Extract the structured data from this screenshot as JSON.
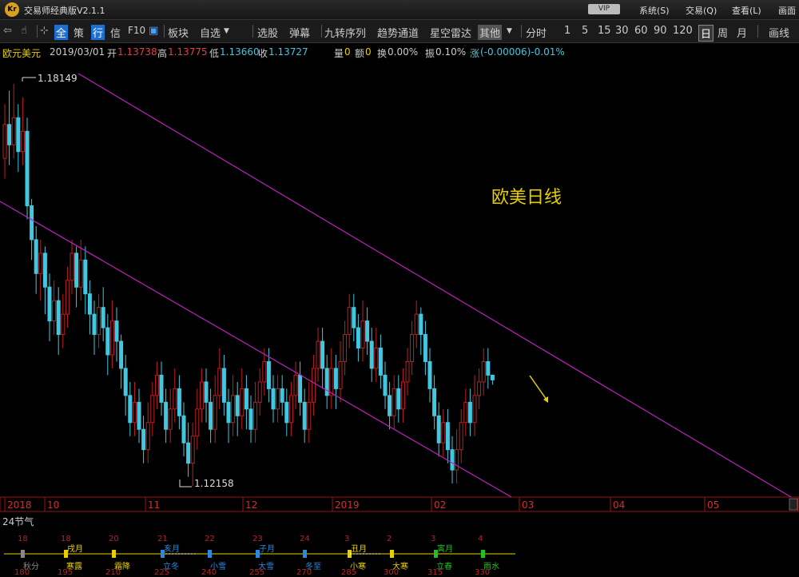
{
  "app": {
    "title": "交易师经典版V2.1.1",
    "logo": "Kr",
    "vip": "VIP",
    "menu": [
      "系统(S)",
      "交易(Q)",
      "查看(L)",
      "画面"
    ]
  },
  "toolbar": {
    "items": [
      "全",
      "策",
      "行",
      "信",
      "F10",
      "板块",
      "自选",
      "选股",
      "弹幕",
      "九转序列",
      "趋势通道",
      "星空雷达",
      "其他",
      "分时",
      "1",
      "5",
      "15",
      "30",
      "60",
      "90",
      "120",
      "日",
      "周",
      "月",
      "画线"
    ],
    "selected": [
      "全",
      "行",
      "日"
    ]
  },
  "quote": {
    "symbol": "欧元美元",
    "date": "2019/03/01",
    "open_label": "开",
    "open": "1.13738",
    "high_label": "高",
    "high": "1.13775",
    "low_label": "低",
    "low": "1.13660",
    "close_label": "收",
    "close": "1.13727",
    "vol_label": "量",
    "vol": "0",
    "amt_label": "额",
    "amt": "0",
    "turnover_label": "换",
    "turnover": "0.00%",
    "amp_label": "振",
    "amp": "0.10%",
    "chg_label": "涨",
    "chg": "(-0.00006)-0.01%"
  },
  "chart_data": {
    "type": "candlestick",
    "title": "欧美日线",
    "high_marker": "1.18149",
    "low_marker": "1.12158",
    "x_ticks": [
      "2018",
      "10",
      "11",
      "12",
      "2019",
      "02",
      "03",
      "04",
      "05"
    ],
    "candles": [
      {
        "o": 1.17,
        "c": 1.175,
        "h": 1.178,
        "l": 1.167
      },
      {
        "o": 1.175,
        "c": 1.172,
        "h": 1.18,
        "l": 1.169
      },
      {
        "o": 1.172,
        "c": 1.176,
        "h": 1.181,
        "l": 1.17
      },
      {
        "o": 1.176,
        "c": 1.171,
        "h": 1.178,
        "l": 1.168
      },
      {
        "o": 1.171,
        "c": 1.174,
        "h": 1.179,
        "l": 1.169
      },
      {
        "o": 1.174,
        "c": 1.163,
        "h": 1.176,
        "l": 1.161
      },
      {
        "o": 1.163,
        "c": 1.158,
        "h": 1.164,
        "l": 1.155
      },
      {
        "o": 1.158,
        "c": 1.153,
        "h": 1.16,
        "l": 1.15
      },
      {
        "o": 1.153,
        "c": 1.156,
        "h": 1.158,
        "l": 1.149
      },
      {
        "o": 1.156,
        "c": 1.151,
        "h": 1.157,
        "l": 1.147
      },
      {
        "o": 1.151,
        "c": 1.146,
        "h": 1.153,
        "l": 1.143
      },
      {
        "o": 1.146,
        "c": 1.149,
        "h": 1.152,
        "l": 1.144
      },
      {
        "o": 1.149,
        "c": 1.144,
        "h": 1.151,
        "l": 1.141
      },
      {
        "o": 1.144,
        "c": 1.147,
        "h": 1.15,
        "l": 1.142
      },
      {
        "o": 1.147,
        "c": 1.152,
        "h": 1.154,
        "l": 1.145
      },
      {
        "o": 1.152,
        "c": 1.156,
        "h": 1.158,
        "l": 1.15
      },
      {
        "o": 1.156,
        "c": 1.151,
        "h": 1.157,
        "l": 1.148
      },
      {
        "o": 1.151,
        "c": 1.155,
        "h": 1.158,
        "l": 1.149
      },
      {
        "o": 1.155,
        "c": 1.15,
        "h": 1.157,
        "l": 1.147
      },
      {
        "o": 1.15,
        "c": 1.147,
        "h": 1.152,
        "l": 1.144
      },
      {
        "o": 1.147,
        "c": 1.144,
        "h": 1.149,
        "l": 1.141
      },
      {
        "o": 1.144,
        "c": 1.148,
        "h": 1.15,
        "l": 1.142
      },
      {
        "o": 1.148,
        "c": 1.145,
        "h": 1.151,
        "l": 1.143
      },
      {
        "o": 1.145,
        "c": 1.141,
        "h": 1.147,
        "l": 1.138
      },
      {
        "o": 1.141,
        "c": 1.146,
        "h": 1.149,
        "l": 1.139
      },
      {
        "o": 1.146,
        "c": 1.143,
        "h": 1.148,
        "l": 1.14
      },
      {
        "o": 1.143,
        "c": 1.139,
        "h": 1.144,
        "l": 1.136
      },
      {
        "o": 1.139,
        "c": 1.135,
        "h": 1.141,
        "l": 1.132
      },
      {
        "o": 1.135,
        "c": 1.131,
        "h": 1.137,
        "l": 1.129
      },
      {
        "o": 1.131,
        "c": 1.134,
        "h": 1.137,
        "l": 1.129
      },
      {
        "o": 1.134,
        "c": 1.13,
        "h": 1.136,
        "l": 1.128
      },
      {
        "o": 1.13,
        "c": 1.127,
        "h": 1.132,
        "l": 1.125
      },
      {
        "o": 1.127,
        "c": 1.131,
        "h": 1.134,
        "l": 1.125
      },
      {
        "o": 1.131,
        "c": 1.135,
        "h": 1.137,
        "l": 1.129
      },
      {
        "o": 1.135,
        "c": 1.138,
        "h": 1.14,
        "l": 1.133
      },
      {
        "o": 1.138,
        "c": 1.134,
        "h": 1.14,
        "l": 1.132
      },
      {
        "o": 1.134,
        "c": 1.13,
        "h": 1.136,
        "l": 1.128
      },
      {
        "o": 1.13,
        "c": 1.133,
        "h": 1.136,
        "l": 1.128
      },
      {
        "o": 1.133,
        "c": 1.136,
        "h": 1.139,
        "l": 1.131
      },
      {
        "o": 1.136,
        "c": 1.132,
        "h": 1.138,
        "l": 1.13
      },
      {
        "o": 1.132,
        "c": 1.128,
        "h": 1.134,
        "l": 1.126
      },
      {
        "o": 1.128,
        "c": 1.125,
        "h": 1.131,
        "l": 1.123
      },
      {
        "o": 1.125,
        "c": 1.129,
        "h": 1.131,
        "l": 1.1216
      },
      {
        "o": 1.129,
        "c": 1.133,
        "h": 1.136,
        "l": 1.127
      },
      {
        "o": 1.133,
        "c": 1.137,
        "h": 1.139,
        "l": 1.131
      },
      {
        "o": 1.137,
        "c": 1.134,
        "h": 1.139,
        "l": 1.131
      },
      {
        "o": 1.134,
        "c": 1.13,
        "h": 1.136,
        "l": 1.128
      },
      {
        "o": 1.13,
        "c": 1.135,
        "h": 1.138,
        "l": 1.128
      },
      {
        "o": 1.135,
        "c": 1.139,
        "h": 1.142,
        "l": 1.133
      },
      {
        "o": 1.139,
        "c": 1.134,
        "h": 1.141,
        "l": 1.132
      },
      {
        "o": 1.134,
        "c": 1.131,
        "h": 1.136,
        "l": 1.128
      },
      {
        "o": 1.131,
        "c": 1.135,
        "h": 1.138,
        "l": 1.129
      },
      {
        "o": 1.135,
        "c": 1.132,
        "h": 1.137,
        "l": 1.129
      },
      {
        "o": 1.132,
        "c": 1.136,
        "h": 1.139,
        "l": 1.13
      },
      {
        "o": 1.136,
        "c": 1.133,
        "h": 1.138,
        "l": 1.13
      },
      {
        "o": 1.133,
        "c": 1.13,
        "h": 1.135,
        "l": 1.128
      },
      {
        "o": 1.13,
        "c": 1.134,
        "h": 1.137,
        "l": 1.128
      },
      {
        "o": 1.134,
        "c": 1.137,
        "h": 1.139,
        "l": 1.132
      },
      {
        "o": 1.137,
        "c": 1.14,
        "h": 1.142,
        "l": 1.135
      },
      {
        "o": 1.14,
        "c": 1.136,
        "h": 1.142,
        "l": 1.134
      },
      {
        "o": 1.136,
        "c": 1.133,
        "h": 1.138,
        "l": 1.131
      },
      {
        "o": 1.133,
        "c": 1.136,
        "h": 1.138,
        "l": 1.131
      },
      {
        "o": 1.136,
        "c": 1.134,
        "h": 1.138,
        "l": 1.132
      },
      {
        "o": 1.134,
        "c": 1.131,
        "h": 1.136,
        "l": 1.129
      },
      {
        "o": 1.131,
        "c": 1.135,
        "h": 1.137,
        "l": 1.129
      },
      {
        "o": 1.135,
        "c": 1.138,
        "h": 1.14,
        "l": 1.133
      },
      {
        "o": 1.138,
        "c": 1.134,
        "h": 1.14,
        "l": 1.132
      },
      {
        "o": 1.134,
        "c": 1.13,
        "h": 1.136,
        "l": 1.128
      },
      {
        "o": 1.13,
        "c": 1.134,
        "h": 1.137,
        "l": 1.128
      },
      {
        "o": 1.134,
        "c": 1.139,
        "h": 1.141,
        "l": 1.132
      },
      {
        "o": 1.139,
        "c": 1.143,
        "h": 1.145,
        "l": 1.137
      },
      {
        "o": 1.143,
        "c": 1.139,
        "h": 1.145,
        "l": 1.136
      },
      {
        "o": 1.139,
        "c": 1.135,
        "h": 1.141,
        "l": 1.133
      },
      {
        "o": 1.135,
        "c": 1.139,
        "h": 1.142,
        "l": 1.133
      },
      {
        "o": 1.139,
        "c": 1.136,
        "h": 1.141,
        "l": 1.133
      },
      {
        "o": 1.136,
        "c": 1.14,
        "h": 1.143,
        "l": 1.134
      },
      {
        "o": 1.14,
        "c": 1.144,
        "h": 1.146,
        "l": 1.138
      },
      {
        "o": 1.144,
        "c": 1.148,
        "h": 1.15,
        "l": 1.142
      },
      {
        "o": 1.148,
        "c": 1.145,
        "h": 1.15,
        "l": 1.143
      },
      {
        "o": 1.145,
        "c": 1.142,
        "h": 1.147,
        "l": 1.14
      },
      {
        "o": 1.142,
        "c": 1.146,
        "h": 1.149,
        "l": 1.14
      },
      {
        "o": 1.146,
        "c": 1.143,
        "h": 1.148,
        "l": 1.141
      },
      {
        "o": 1.143,
        "c": 1.139,
        "h": 1.145,
        "l": 1.137
      },
      {
        "o": 1.139,
        "c": 1.142,
        "h": 1.145,
        "l": 1.137
      },
      {
        "o": 1.142,
        "c": 1.138,
        "h": 1.144,
        "l": 1.136
      },
      {
        "o": 1.138,
        "c": 1.135,
        "h": 1.14,
        "l": 1.133
      },
      {
        "o": 1.135,
        "c": 1.132,
        "h": 1.137,
        "l": 1.13
      },
      {
        "o": 1.132,
        "c": 1.136,
        "h": 1.138,
        "l": 1.13
      },
      {
        "o": 1.136,
        "c": 1.133,
        "h": 1.138,
        "l": 1.131
      },
      {
        "o": 1.133,
        "c": 1.137,
        "h": 1.139,
        "l": 1.131
      },
      {
        "o": 1.137,
        "c": 1.14,
        "h": 1.142,
        "l": 1.135
      },
      {
        "o": 1.14,
        "c": 1.144,
        "h": 1.146,
        "l": 1.138
      },
      {
        "o": 1.144,
        "c": 1.147,
        "h": 1.149,
        "l": 1.142
      },
      {
        "o": 1.147,
        "c": 1.144,
        "h": 1.148,
        "l": 1.141
      },
      {
        "o": 1.144,
        "c": 1.14,
        "h": 1.146,
        "l": 1.138
      },
      {
        "o": 1.14,
        "c": 1.136,
        "h": 1.142,
        "l": 1.134
      },
      {
        "o": 1.136,
        "c": 1.132,
        "h": 1.138,
        "l": 1.13
      },
      {
        "o": 1.132,
        "c": 1.128,
        "h": 1.134,
        "l": 1.126
      },
      {
        "o": 1.128,
        "c": 1.131,
        "h": 1.133,
        "l": 1.126
      },
      {
        "o": 1.131,
        "c": 1.127,
        "h": 1.133,
        "l": 1.125
      },
      {
        "o": 1.127,
        "c": 1.124,
        "h": 1.129,
        "l": 1.122
      },
      {
        "o": 1.124,
        "c": 1.127,
        "h": 1.13,
        "l": 1.122
      },
      {
        "o": 1.127,
        "c": 1.131,
        "h": 1.133,
        "l": 1.125
      },
      {
        "o": 1.131,
        "c": 1.134,
        "h": 1.136,
        "l": 1.129
      },
      {
        "o": 1.134,
        "c": 1.131,
        "h": 1.136,
        "l": 1.129
      },
      {
        "o": 1.131,
        "c": 1.135,
        "h": 1.138,
        "l": 1.129
      },
      {
        "o": 1.135,
        "c": 1.137,
        "h": 1.139,
        "l": 1.133
      },
      {
        "o": 1.137,
        "c": 1.14,
        "h": 1.142,
        "l": 1.135
      },
      {
        "o": 1.14,
        "c": 1.138,
        "h": 1.142,
        "l": 1.136
      },
      {
        "o": 1.138,
        "c": 1.1373,
        "h": 1.1378,
        "l": 1.1366
      }
    ]
  },
  "solar_terms": {
    "title": "24节气",
    "items": [
      {
        "day": "18",
        "name": "秋分",
        "month": "",
        "deg": "180",
        "color": "#888888"
      },
      {
        "day": "18",
        "name": "寒露",
        "month": "戌月",
        "deg": "195",
        "color": "#e8d000"
      },
      {
        "day": "20",
        "name": "霜降",
        "month": "",
        "deg": "210",
        "color": "#e8d000"
      },
      {
        "day": "21",
        "name": "立冬",
        "month": "亥月",
        "deg": "225",
        "color": "#2a8ae0"
      },
      {
        "day": "22",
        "name": "小雪",
        "month": "",
        "deg": "240",
        "color": "#2a8ae0"
      },
      {
        "day": "23",
        "name": "大雪",
        "month": "子月",
        "deg": "255",
        "color": "#2a8ae0"
      },
      {
        "day": "24",
        "name": "冬至",
        "month": "",
        "deg": "270",
        "color": "#2a8ae0"
      },
      {
        "day": "3",
        "name": "小寒",
        "month": "丑月",
        "deg": "285",
        "color": "#e8d000"
      },
      {
        "day": "2",
        "name": "大寒",
        "month": "",
        "deg": "300",
        "color": "#e8d000"
      },
      {
        "day": "3",
        "name": "立春",
        "month": "寅月",
        "deg": "315",
        "color": "#20c020"
      },
      {
        "day": "4",
        "name": "雨水",
        "month": "",
        "deg": "330",
        "color": "#20c020"
      }
    ]
  },
  "colors": {
    "up": "#c02020",
    "down": "#40c8e0",
    "channel": "#c020c0",
    "axis": "#a01010",
    "label": "#e8d000"
  }
}
